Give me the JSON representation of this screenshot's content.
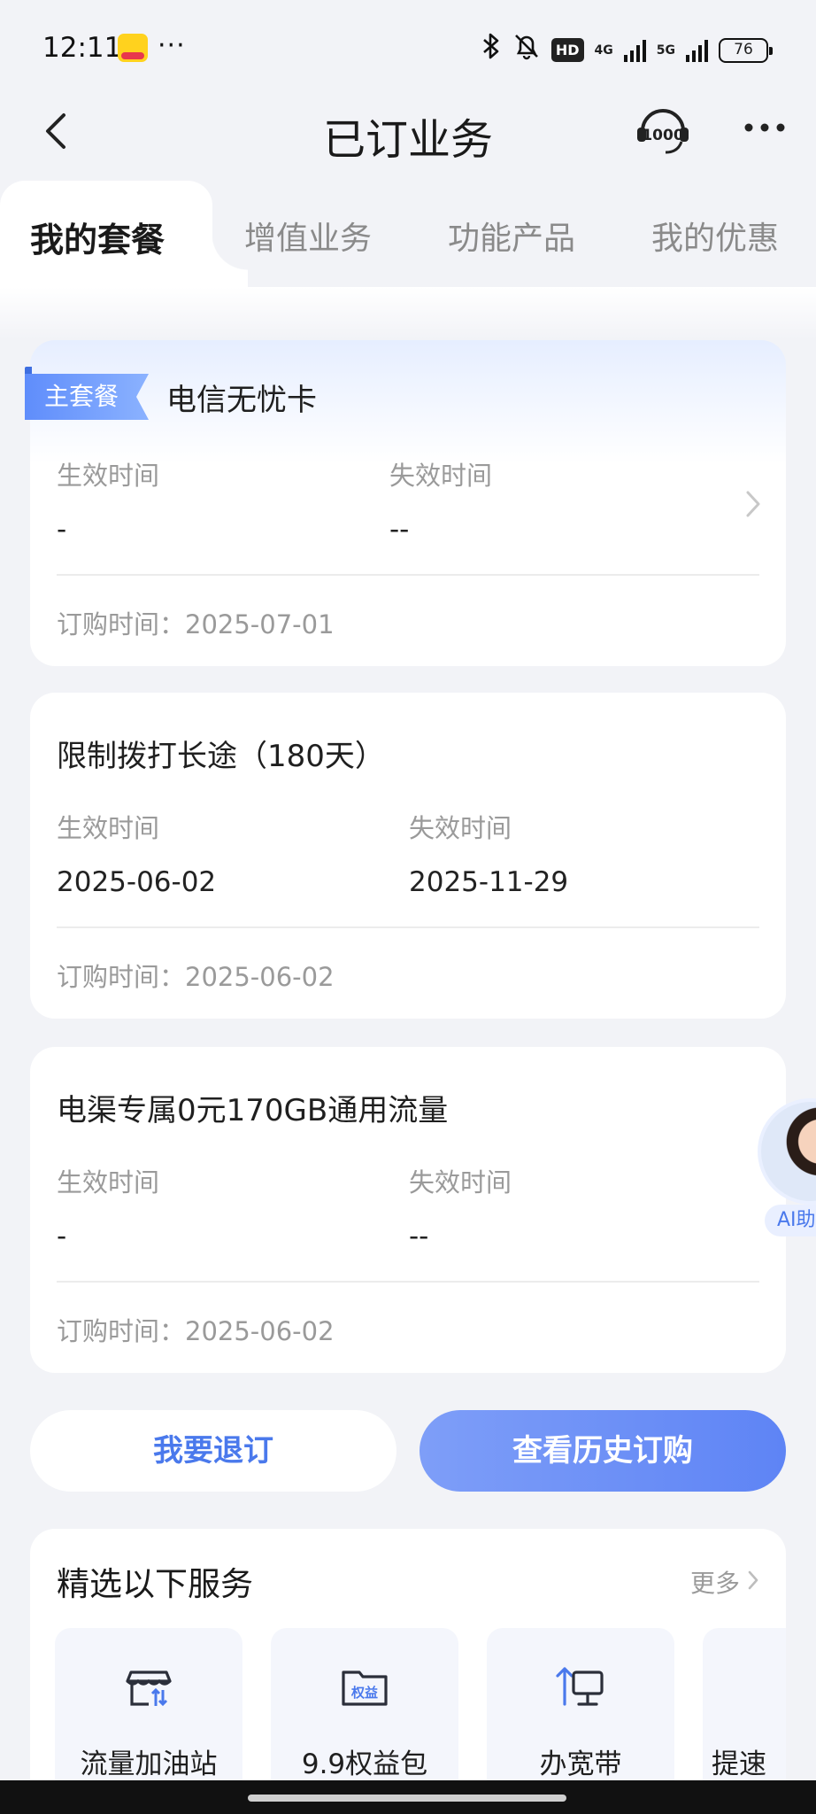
{
  "status_bar": {
    "time": "12:11",
    "meituan_icon": "meituan-app-icon",
    "dots": "···",
    "network_4g": "4G",
    "network_5g": "5G",
    "hd": "HD",
    "battery": "76"
  },
  "header": {
    "title": "已订业务"
  },
  "tabs": [
    {
      "label": "我的套餐",
      "active": true
    },
    {
      "label": "增值业务",
      "active": false
    },
    {
      "label": "功能产品",
      "active": false
    },
    {
      "label": "我的优惠",
      "active": false
    }
  ],
  "cards": [
    {
      "badge": "主套餐",
      "title": "电信无忧卡",
      "start_label": "生效时间",
      "start_value": "-",
      "end_label": "失效时间",
      "end_value": "--",
      "order_time": "订购时间：2025-07-01"
    },
    {
      "title": "限制拨打长途（180天）",
      "start_label": "生效时间",
      "start_value": "2025-06-02",
      "end_label": "失效时间",
      "end_value": "2025-11-29",
      "order_time": "订购时间：2025-06-02"
    },
    {
      "title": "电渠专属0元170GB通用流量",
      "start_label": "生效时间",
      "start_value": "-",
      "end_label": "失效时间",
      "end_value": "--",
      "order_time": "订购时间：2025-06-02"
    }
  ],
  "buttons": {
    "unsubscribe": "我要退订",
    "history": "查看历史订购"
  },
  "services": {
    "title": "精选以下服务",
    "more": "更多",
    "items": [
      {
        "label": "流量加油站",
        "icon": "data-station-icon"
      },
      {
        "label": "9.9权益包",
        "icon": "benefits-package-icon",
        "icon_text": "权益"
      },
      {
        "label": "办宽带",
        "icon": "broadband-icon"
      },
      {
        "label": "提速",
        "icon": "speed-up-icon"
      }
    ]
  },
  "ai_assistant": {
    "label": "AI助手"
  },
  "colors": {
    "accent": "#5e84f5",
    "page_bg": "#f2f3f7",
    "muted_text": "#9a9a9a"
  }
}
